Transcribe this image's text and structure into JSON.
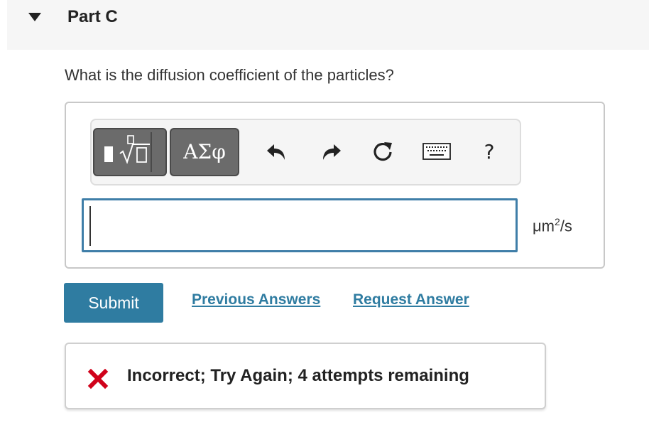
{
  "part": {
    "title": "Part C",
    "expanded": true
  },
  "question": {
    "text": "What is the diffusion coefficient of the particles?"
  },
  "toolbar": {
    "templates_icon": "templates-icon",
    "greek_label": "ΑΣφ",
    "undo_icon": "undo-icon",
    "redo_icon": "redo-icon",
    "reset_icon": "reset-icon",
    "keyboard_icon": "keyboard-icon",
    "help_label": "?"
  },
  "answer": {
    "value": "",
    "unit_base": "μm",
    "unit_exp": "2",
    "unit_tail": "/s"
  },
  "actions": {
    "submit_label": "Submit",
    "previous_answers_label": "Previous Answers",
    "request_answer_label": "Request Answer"
  },
  "feedback": {
    "text": "Incorrect; Try Again; 4 attempts remaining",
    "status": "incorrect"
  },
  "colors": {
    "accent": "#2f7ca1",
    "error": "#d0021b",
    "header_bg": "#f6f6f6"
  }
}
